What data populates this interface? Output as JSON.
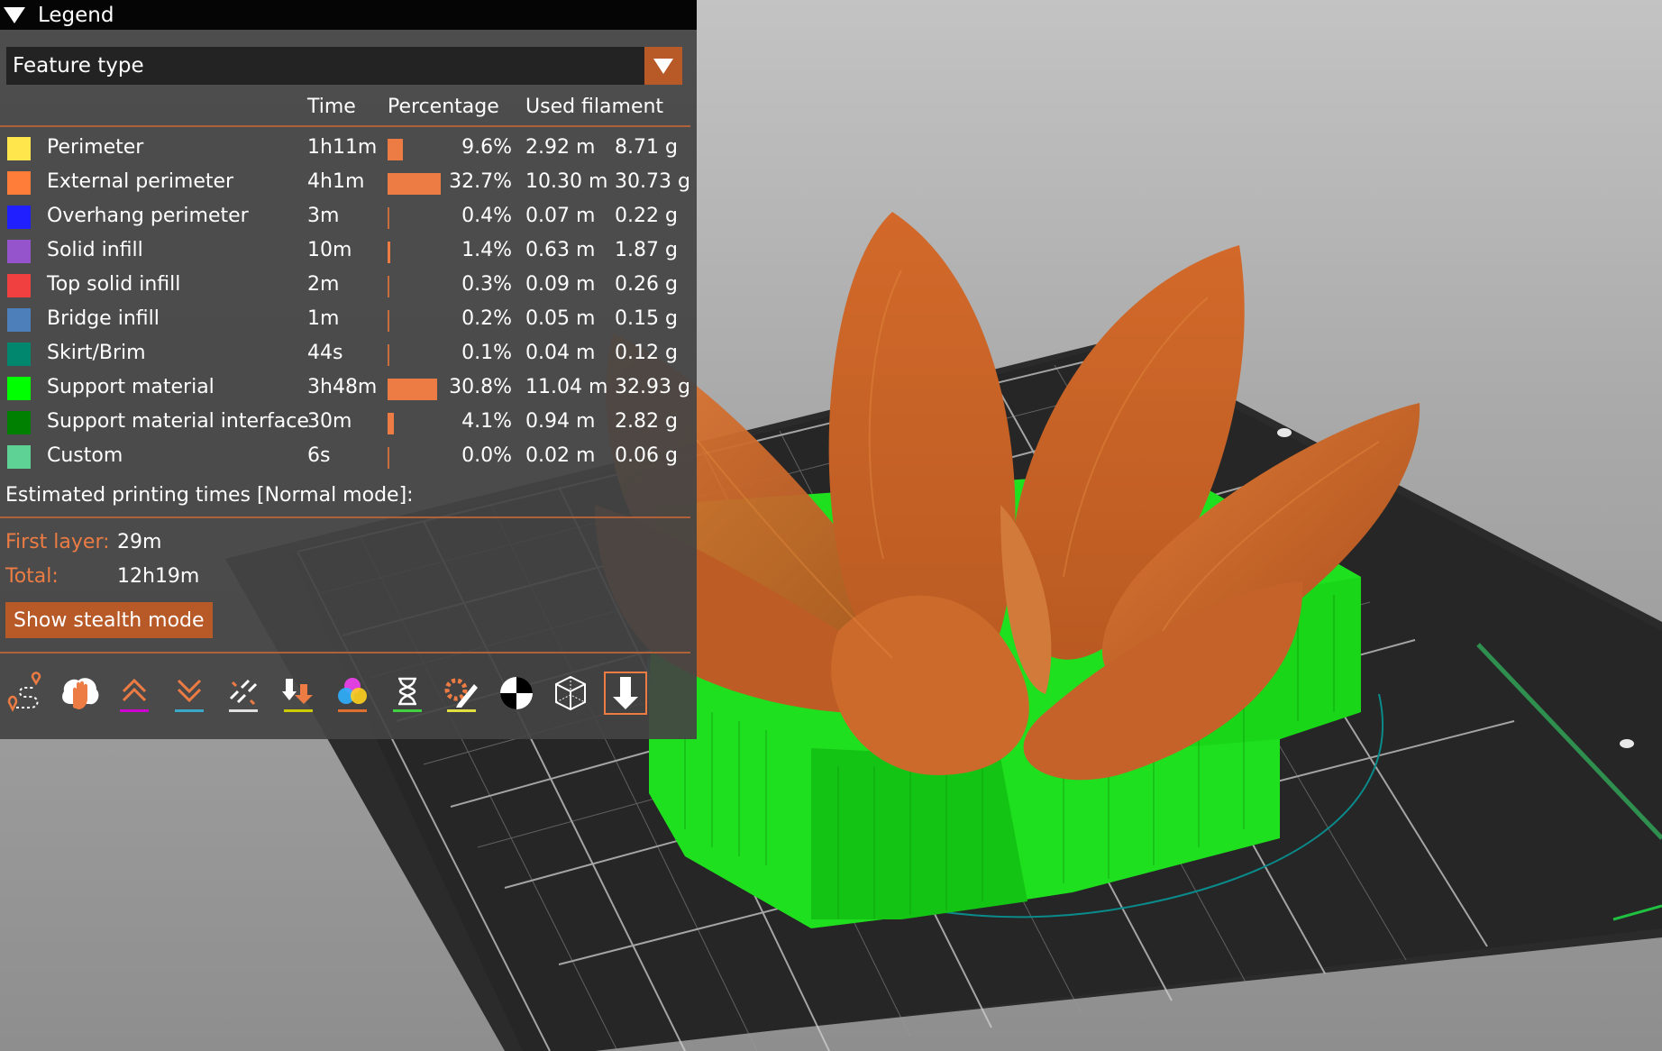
{
  "legend": {
    "title": "Legend",
    "view_type": "Feature type",
    "headers": {
      "time": "Time",
      "percentage": "Percentage",
      "used_filament": "Used filament"
    },
    "rows": [
      {
        "name": "Perimeter",
        "color": "#ffe64d",
        "time": "1h11m",
        "bar": 0.096,
        "percentage": "9.6%",
        "length": "2.92 m",
        "weight": "8.71 g"
      },
      {
        "name": "External perimeter",
        "color": "#ff7d38",
        "time": "4h1m",
        "bar": 0.327,
        "percentage": "32.7%",
        "length": "10.30 m",
        "weight": "30.73 g"
      },
      {
        "name": "Overhang perimeter",
        "color": "#1f1fff",
        "time": "3m",
        "bar": 0.004,
        "percentage": "0.4%",
        "length": "0.07 m",
        "weight": "0.22 g"
      },
      {
        "name": "Solid infill",
        "color": "#9654cc",
        "time": "10m",
        "bar": 0.014,
        "percentage": "1.4%",
        "length": "0.63 m",
        "weight": "1.87 g"
      },
      {
        "name": "Top solid infill",
        "color": "#f04040",
        "time": "2m",
        "bar": 0.003,
        "percentage": "0.3%",
        "length": "0.09 m",
        "weight": "0.26 g"
      },
      {
        "name": "Bridge infill",
        "color": "#4d80ba",
        "time": "1m",
        "bar": 0.002,
        "percentage": "0.2%",
        "length": "0.05 m",
        "weight": "0.15 g"
      },
      {
        "name": "Skirt/Brim",
        "color": "#00876e",
        "time": "44s",
        "bar": 0.001,
        "percentage": "0.1%",
        "length": "0.04 m",
        "weight": "0.12 g"
      },
      {
        "name": "Support material",
        "color": "#00ff00",
        "time": "3h48m",
        "bar": 0.308,
        "percentage": "30.8%",
        "length": "11.04 m",
        "weight": "32.93 g"
      },
      {
        "name": "Support material interface",
        "color": "#008000",
        "time": "30m",
        "bar": 0.041,
        "percentage": "4.1%",
        "length": "0.94 m",
        "weight": "2.82 g"
      },
      {
        "name": "Custom",
        "color": "#5ed194",
        "time": "6s",
        "bar": 0.0,
        "percentage": "0.0%",
        "length": "0.02 m",
        "weight": "0.06 g"
      }
    ],
    "estimated_label": "Estimated printing times [Normal mode]:",
    "first_layer_label": "First layer:",
    "first_layer_value": "29m",
    "total_label": "Total:",
    "total_value": "12h19m",
    "stealth_button": "Show stealth mode",
    "toolbar": [
      {
        "icon": "travel-icon"
      },
      {
        "icon": "wipe-icon"
      },
      {
        "icon": "retractions-icon",
        "accent": "#d000d0"
      },
      {
        "icon": "deretractions-icon",
        "accent": "#3aa8c8"
      },
      {
        "icon": "seams-icon",
        "accent": "#e0e0e0"
      },
      {
        "icon": "tool-changes-icon",
        "accent": "#cccc00"
      },
      {
        "icon": "color-changes-icon",
        "accent": "#e07030"
      },
      {
        "icon": "pause-prints-icon",
        "accent": "#40d040"
      },
      {
        "icon": "custom-gcodes-icon",
        "accent": "#e0e040"
      },
      {
        "icon": "center-of-gravity-icon"
      },
      {
        "icon": "shells-icon"
      },
      {
        "icon": "tool-marker-icon",
        "active": true
      }
    ]
  }
}
